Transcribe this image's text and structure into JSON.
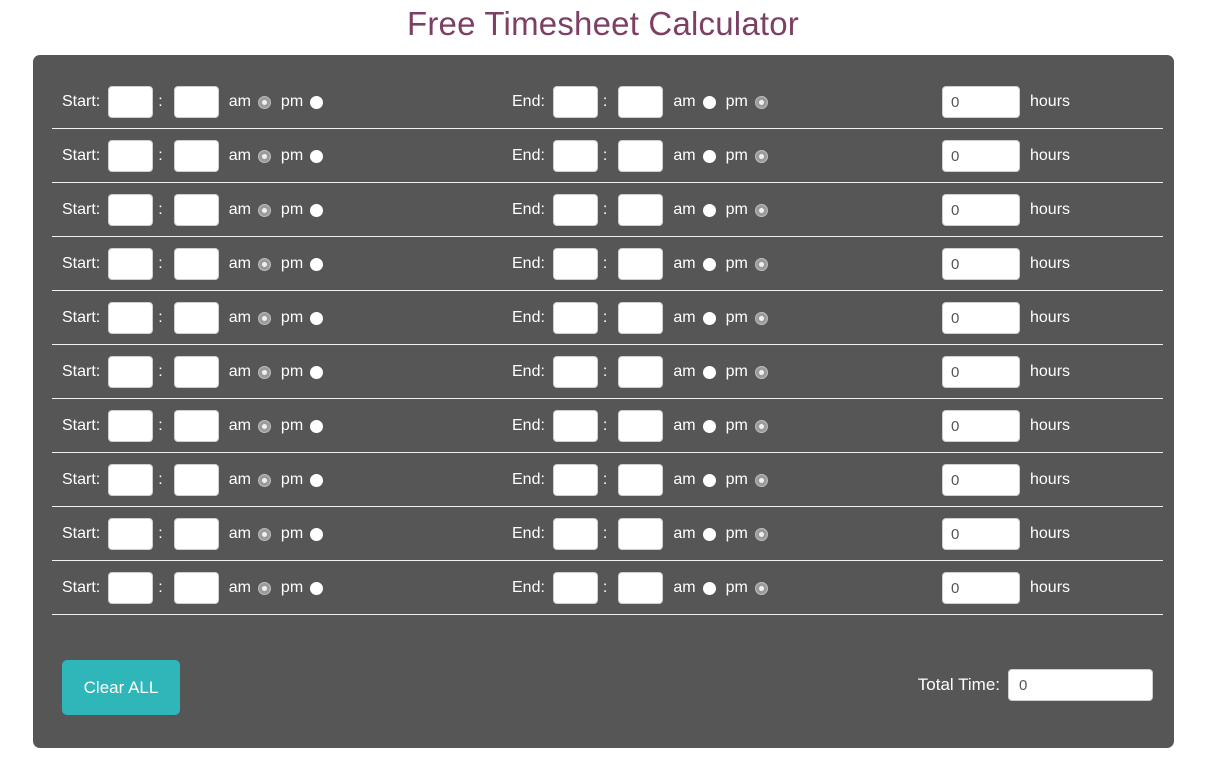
{
  "page": {
    "title": "Free Timesheet Calculator",
    "title_color": "#7d3f63",
    "background": "#ffffff"
  },
  "panel": {
    "background": "#565656",
    "divider_color": "#f0f0f0"
  },
  "labels": {
    "start": "Start:",
    "end": "End:",
    "colon": ":",
    "am": "am",
    "pm": "pm",
    "hours": "hours"
  },
  "rows": [
    {
      "start_hh": "",
      "start_mm": "",
      "start_ampm": "am",
      "end_hh": "",
      "end_mm": "",
      "end_ampm": "pm",
      "hours": "0"
    },
    {
      "start_hh": "",
      "start_mm": "",
      "start_ampm": "am",
      "end_hh": "",
      "end_mm": "",
      "end_ampm": "pm",
      "hours": "0"
    },
    {
      "start_hh": "",
      "start_mm": "",
      "start_ampm": "am",
      "end_hh": "",
      "end_mm": "",
      "end_ampm": "pm",
      "hours": "0"
    },
    {
      "start_hh": "",
      "start_mm": "",
      "start_ampm": "am",
      "end_hh": "",
      "end_mm": "",
      "end_ampm": "pm",
      "hours": "0"
    },
    {
      "start_hh": "",
      "start_mm": "",
      "start_ampm": "am",
      "end_hh": "",
      "end_mm": "",
      "end_ampm": "pm",
      "hours": "0"
    },
    {
      "start_hh": "",
      "start_mm": "",
      "start_ampm": "am",
      "end_hh": "",
      "end_mm": "",
      "end_ampm": "pm",
      "hours": "0"
    },
    {
      "start_hh": "",
      "start_mm": "",
      "start_ampm": "am",
      "end_hh": "",
      "end_mm": "",
      "end_ampm": "pm",
      "hours": "0"
    },
    {
      "start_hh": "",
      "start_mm": "",
      "start_ampm": "am",
      "end_hh": "",
      "end_mm": "",
      "end_ampm": "pm",
      "hours": "0"
    },
    {
      "start_hh": "",
      "start_mm": "",
      "start_ampm": "am",
      "end_hh": "",
      "end_mm": "",
      "end_ampm": "pm",
      "hours": "0"
    },
    {
      "start_hh": "",
      "start_mm": "",
      "start_ampm": "am",
      "end_hh": "",
      "end_mm": "",
      "end_ampm": "pm",
      "hours": "0"
    }
  ],
  "footer": {
    "clear_label": "Clear ALL",
    "clear_color": "#2fb6b8",
    "total_label": "Total Time:",
    "total_value": "0"
  }
}
